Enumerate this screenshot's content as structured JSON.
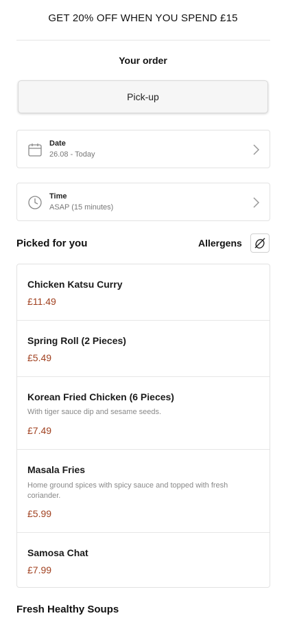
{
  "promo": {
    "text": "GET 20% OFF WHEN YOU SPEND £15"
  },
  "order": {
    "title": "Your order",
    "mode_button": "Pick-up",
    "date": {
      "label": "Date",
      "value": "26.08 - Today",
      "icon": "calendar-icon"
    },
    "time": {
      "label": "Time",
      "value": "ASAP (15 minutes)",
      "icon": "clock-icon"
    }
  },
  "picked": {
    "title": "Picked for you",
    "allergens_label": "Allergens",
    "allergens_icon": "allergen-filter-icon",
    "items": [
      {
        "name": "Chicken Katsu Curry",
        "description": "",
        "price": "£11.49"
      },
      {
        "name": "Spring Roll (2 Pieces)",
        "description": "",
        "price": "£5.49"
      },
      {
        "name": "Korean Fried Chicken (6 Pieces)",
        "description": "With tiger sauce dip and sesame seeds.",
        "price": "£7.49"
      },
      {
        "name": "Masala Fries",
        "description": "Home ground spices with spicy sauce and topped with fresh coriander.",
        "price": "£5.99"
      },
      {
        "name": "Samosa Chat",
        "description": "",
        "price": "£7.99"
      }
    ]
  },
  "next_section": {
    "title": "Fresh Healthy Soups"
  },
  "colors": {
    "price": "#a0401f",
    "border": "#e2e2e2",
    "muted_text": "#888888"
  }
}
